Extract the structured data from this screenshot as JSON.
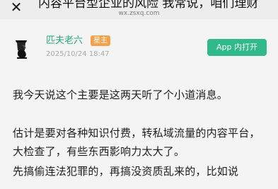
{
  "header": {
    "close_icon": "close-icon",
    "title": "内容平台型企业的风险 我常说，咱们理财",
    "url": "wx.zsxq.com"
  },
  "post": {
    "author": "匹夫老六",
    "badge": "星主",
    "date": "2025/10/24 18:47",
    "app_button": "App 内打开",
    "paragraphs": [
      "我今天说这个主要是这两天听了个小道消息。",
      "估计是要对各种知识付费，转私域流量的内容平台，大检查了，有些东西影响力太大了。",
      "先搞偷连法犯罪的，再搞没资质乱来的，比如说"
    ]
  },
  "colors": {
    "accent_green": "#30b98a",
    "author_green": "#2aa57d",
    "badge_orange": "#f1a24b"
  }
}
